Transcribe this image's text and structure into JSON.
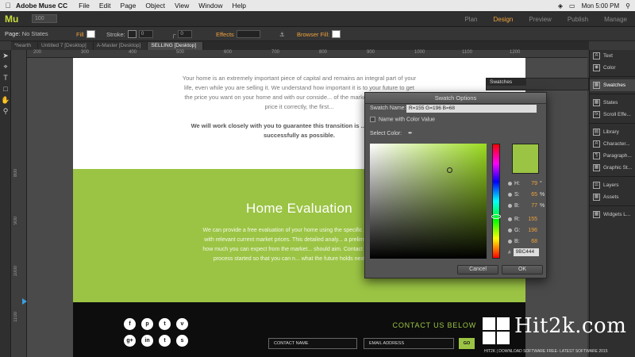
{
  "menubar": {
    "app": "Adobe Muse CC",
    "items": [
      "File",
      "Edit",
      "Page",
      "Object",
      "View",
      "Window",
      "Help"
    ],
    "clock": "Mon 5:00 PM"
  },
  "appbar": {
    "logo": "Mu",
    "workspaces": [
      "Plan",
      "Design",
      "Preview",
      "Publish",
      "Manage"
    ],
    "active_workspace": "Design"
  },
  "controlbar": {
    "page_label": "Page:",
    "page_value": "No States",
    "fill_label": "Fill",
    "stroke_label": "Stroke:",
    "stroke_value": "0",
    "size_value": "0",
    "effects_label": "Effects",
    "browser_fill_label": "Browser Fill:"
  },
  "doc_tabs": [
    "*hearth",
    "Untitled 7 [Desktop]",
    "A-Master [Desktop]",
    "SELLING [Desktop]"
  ],
  "ruler": {
    "h": [
      "200",
      "300",
      "400",
      "500",
      "600",
      "700",
      "800",
      "900",
      "1000",
      "1100",
      "1200"
    ],
    "v": [
      "800",
      "900",
      "1000",
      "1100"
    ]
  },
  "page": {
    "intro_text": "Your home is an extremely important piece of capital and remains an integral part of your life, even while you are selling it. We understand how important it is to your future to get the price you want on your home and with our conside... of the market, we know how to price it correctly, the first...",
    "intro_bold": "We will work closely with you to guarantee this transition is ... efficiently and successfully as possible.",
    "section_title": "Home Evaluation",
    "section_text": "We can provide a free evaluation of your home using the specific ... compare it with relevant current market prices. This detailed analy... a preliminary idea of how much you can expect from the market... should aim. Contact us to get this process started so that you can n... what the future holds next for you.",
    "social_icons": [
      "f",
      "p",
      "t",
      "v",
      "g+",
      "in",
      "t",
      "s"
    ],
    "contact_title": "CONTACT US BELOW",
    "contact_name_placeholder": "CONTACT NAME",
    "email_placeholder": "EMAIL ADDRESS",
    "go_label": "GO"
  },
  "right_panel": {
    "items": [
      "Text",
      "Color",
      "Swatches",
      "States",
      "Scroll Effe...",
      "Library",
      "Character...",
      "Paragraph...",
      "Graphic St...",
      "Layers",
      "Assets",
      "Widgets L..."
    ]
  },
  "swatches_panel": {
    "title": "Swatches"
  },
  "dialog": {
    "title": "Swatch Options",
    "swatch_name_label": "Swatch Name:",
    "swatch_name_value": "R=155 G=196 B=68",
    "name_with_color_label": "Name with Color Value",
    "select_color_label": "Select Color:",
    "h_label": "H:",
    "h_value": "79",
    "h_unit": "°",
    "s_label": "S:",
    "s_value": "65",
    "s_unit": "%",
    "b_label": "B:",
    "b_value": "77",
    "b_unit": "%",
    "r_label": "R:",
    "r_value": "155",
    "g_label": "G:",
    "g_value": "196",
    "bl_label": "B:",
    "bl_value": "68",
    "hex_prefix": "#",
    "hex_value": "9BC444",
    "cancel_label": "Cancel",
    "ok_label": "OK",
    "swatch_color": "#9bc444"
  },
  "watermark": {
    "brand": "Hit2k.com",
    "tagline": "HIT2K | DOWNLOAD SOFTWARE FREE- LATEST SOFTWARE 2015"
  }
}
